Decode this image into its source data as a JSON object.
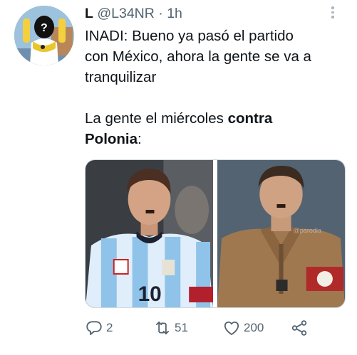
{
  "tweet": {
    "display_name": "L",
    "handle": "@L34NR",
    "separator": "·",
    "time": "1h",
    "text_lines_1": [
      "INADI: Bueno ya pasó el partido",
      "con México, ahora la gente se va a",
      "tranquilizar"
    ],
    "text_2_prefix": "La gente el miércoles ",
    "text_2_bold_a": "contra",
    "text_2_bold_b": "Polonia",
    "text_2_suffix": ":"
  },
  "media": {
    "left_number": "10",
    "watermark": "@parodia"
  },
  "actions": {
    "reply_count": "2",
    "retweet_count": "51",
    "like_count": "200"
  },
  "colors": {
    "text": "#0f1419",
    "secondary": "#536471",
    "border": "#cfd9de"
  },
  "icons": [
    "more-icon",
    "reply-icon",
    "retweet-icon",
    "like-icon",
    "share-icon"
  ]
}
